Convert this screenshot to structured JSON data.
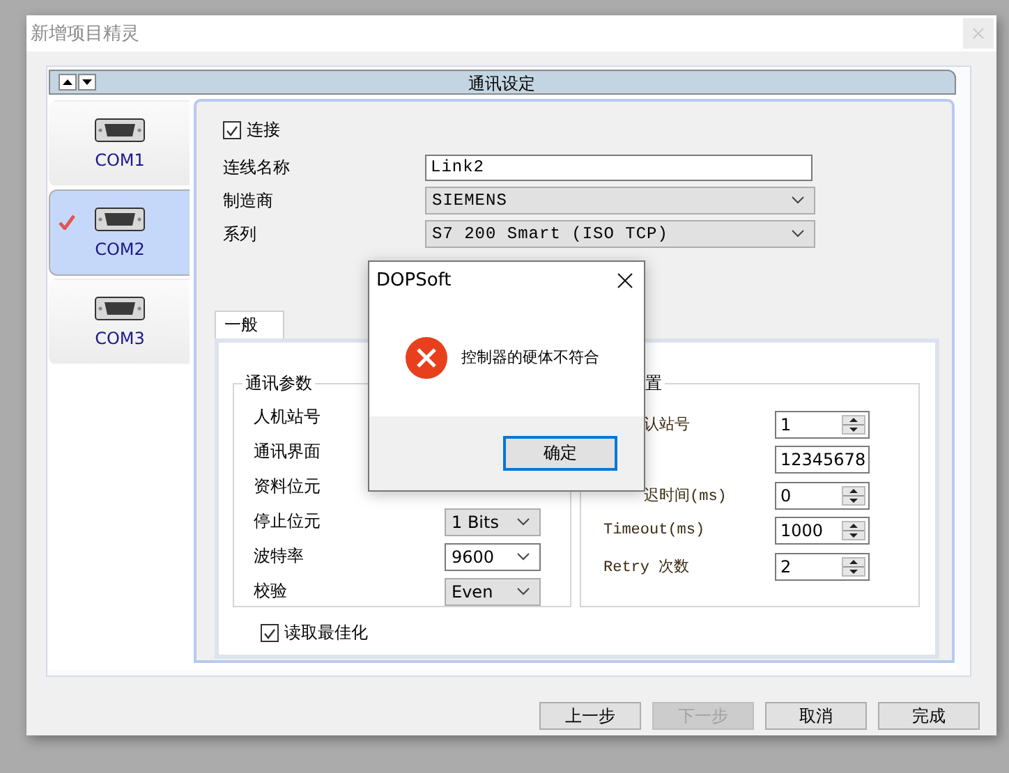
{
  "window": {
    "title": "新增项目精灵"
  },
  "panel": {
    "title": "通讯设定"
  },
  "ports": [
    {
      "label": "COM1",
      "selected": false,
      "configured": false
    },
    {
      "label": "COM2",
      "selected": true,
      "configured": true
    },
    {
      "label": "COM3",
      "selected": false,
      "configured": false
    }
  ],
  "connect": {
    "label": "连接",
    "checked": true
  },
  "fields": [
    {
      "label": "连线名称",
      "kind": "text",
      "value": "Link2"
    },
    {
      "label": "制造商",
      "kind": "dropdown",
      "value": "SIEMENS"
    },
    {
      "label": "系列",
      "kind": "dropdown",
      "value": "S7 200 Smart (ISO TCP)"
    }
  ],
  "subtabs": [
    {
      "label": "一般",
      "selected": true
    }
  ],
  "comm_params": {
    "title": "通讯参数",
    "rows": [
      {
        "label": "人机站号"
      },
      {
        "label": "通讯界面"
      },
      {
        "label": "资料位元"
      },
      {
        "label": "停止位元",
        "value": "1 Bits",
        "disabled": true
      },
      {
        "label": "波特率",
        "value": "9600",
        "disabled": false
      },
      {
        "label": "校验",
        "value": "Even",
        "disabled": true
      }
    ]
  },
  "settings": {
    "title": "置",
    "rows": [
      {
        "label": "认站号",
        "kind": "spin",
        "value": "1",
        "cut": true
      },
      {
        "kind": "text",
        "value": "12345678"
      },
      {
        "label": "迟时间(ms)",
        "kind": "spin",
        "value": "0",
        "cut": true
      },
      {
        "label": "Timeout(ms)",
        "kind": "spin",
        "value": "1000",
        "cut": false
      },
      {
        "label": "Retry 次数",
        "kind": "spin",
        "value": "2",
        "cut": false
      }
    ]
  },
  "optimize": {
    "label": "读取最佳化",
    "checked": true
  },
  "buttons": [
    {
      "label": "上一步",
      "disabled": false
    },
    {
      "label": "下一步",
      "disabled": true
    },
    {
      "label": "取消",
      "disabled": false
    },
    {
      "label": "完成",
      "disabled": false
    }
  ],
  "message_box": {
    "title": "DOPSoft",
    "message": "控制器的硬体不符合",
    "button": "确定"
  }
}
